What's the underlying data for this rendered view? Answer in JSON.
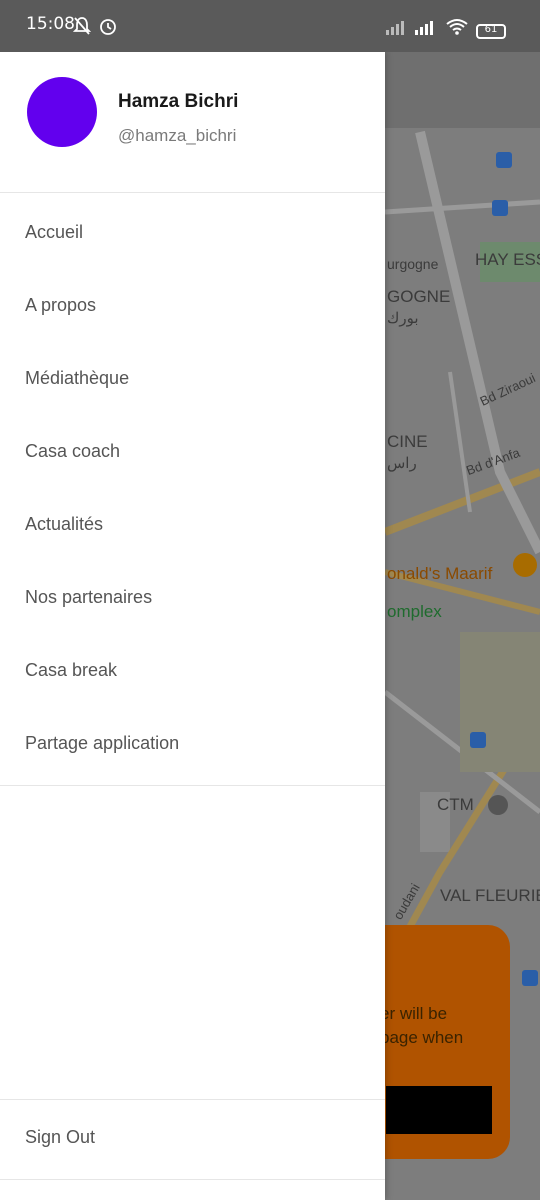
{
  "status_bar": {
    "time": "15:08",
    "battery": "61",
    "icons": [
      "muted-bell-icon",
      "alarm-icon",
      "signal-icon",
      "signal-icon",
      "wifi-icon",
      "battery-icon"
    ]
  },
  "drawer": {
    "user": {
      "name": "Hamza Bichri",
      "handle": "@hamza_bichri",
      "avatar_color": "#6200ee"
    },
    "menu": [
      {
        "label": "Accueil"
      },
      {
        "label": "A propos"
      },
      {
        "label": "Médiathèque"
      },
      {
        "label": "Casa coach"
      },
      {
        "label": "Actualités"
      },
      {
        "label": "Nos partenaires"
      },
      {
        "label": "Casa break"
      },
      {
        "label": "Partage application"
      }
    ],
    "sign_out": "Sign Out"
  },
  "map": {
    "labels": [
      "HAY ESS",
      "urgogne",
      "GOGNE",
      "بورك",
      "Bd Ziraoui",
      "CINE",
      "راس",
      "Bd d'Anfa",
      "onald's Maarif",
      "omplex",
      "CTM",
      "oudani",
      "VAL FLEURIE"
    ],
    "card": {
      "line1": "er will be",
      "line2": "page when"
    },
    "card_color": "#b05300"
  }
}
